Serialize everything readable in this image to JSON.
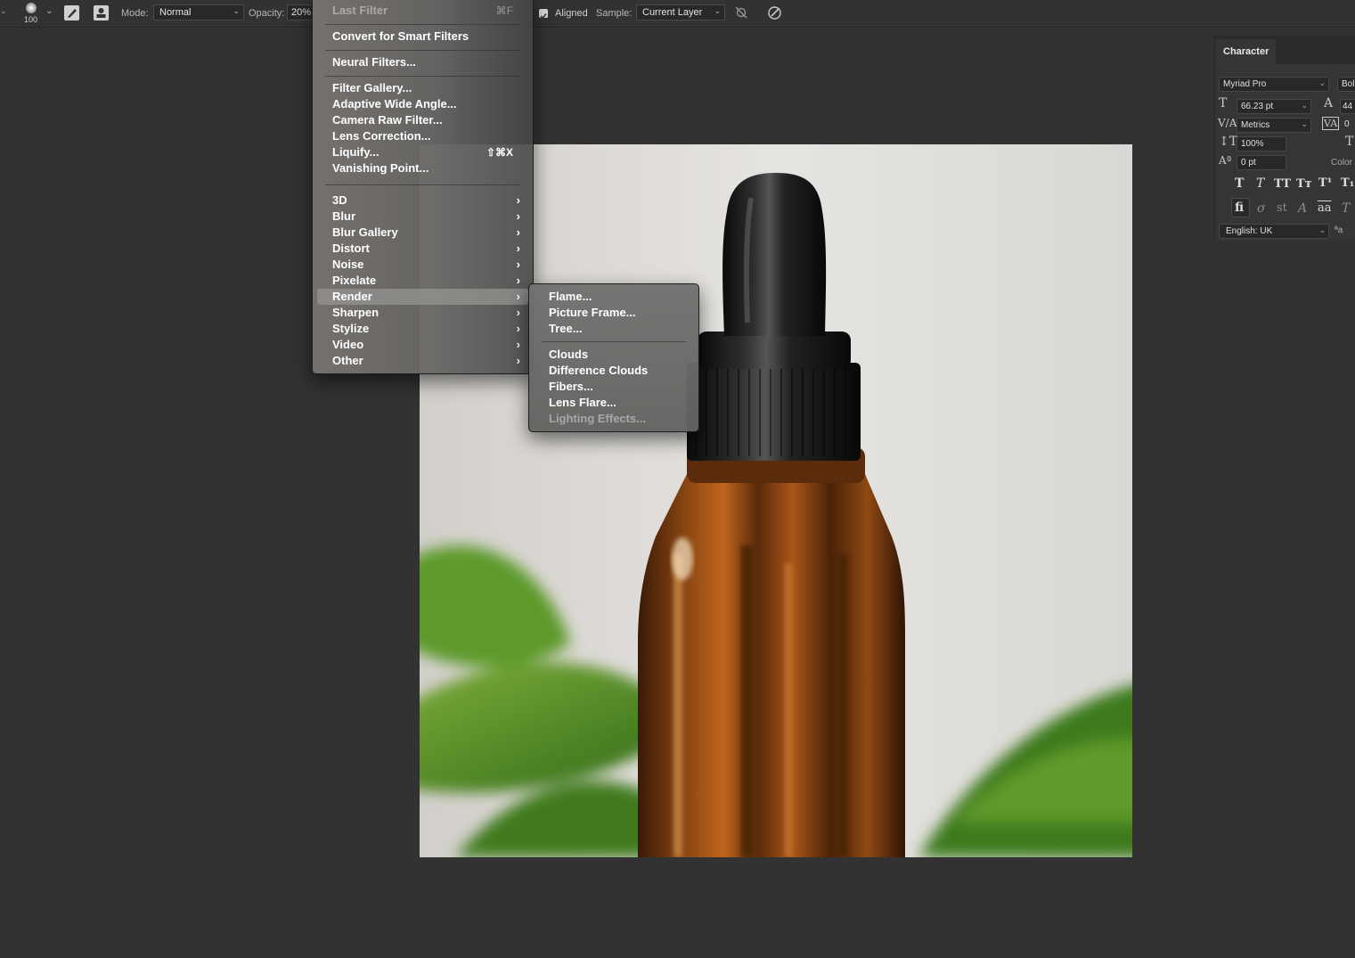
{
  "options_bar": {
    "brush_size": "100",
    "mode_label": "Mode:",
    "mode_value": "Normal",
    "opacity_label": "Opacity:",
    "opacity_value": "20%",
    "aligned_label": "Aligned",
    "aligned_checked": true,
    "sample_label": "Sample:",
    "sample_value": "Current Layer"
  },
  "filter_menu": {
    "last_filter": {
      "label": "Last Filter",
      "shortcut": "⌘F"
    },
    "convert": "Convert for Smart Filters",
    "neural": "Neural Filters...",
    "group1": [
      {
        "label": "Filter Gallery...",
        "shortcut": ""
      },
      {
        "label": "Adaptive Wide Angle...",
        "shortcut": ""
      },
      {
        "label": "Camera Raw Filter...",
        "shortcut": ""
      },
      {
        "label": "Lens Correction...",
        "shortcut": ""
      },
      {
        "label": "Liquify...",
        "shortcut": "⇧⌘X"
      },
      {
        "label": "Vanishing Point...",
        "shortcut": ""
      }
    ],
    "submenus": [
      "3D",
      "Blur",
      "Blur Gallery",
      "Distort",
      "Noise",
      "Pixelate",
      "Render",
      "Sharpen",
      "Stylize",
      "Video",
      "Other"
    ],
    "highlighted": "Render"
  },
  "render_submenu": {
    "group1": [
      "Flame...",
      "Picture Frame...",
      "Tree..."
    ],
    "group2": [
      "Clouds",
      "Difference Clouds",
      "Fibers...",
      "Lens Flare..."
    ],
    "disabled": "Lighting Effects..."
  },
  "character_panel": {
    "tab": "Character",
    "font_family": "Myriad Pro",
    "font_style": "Bol",
    "font_size": "66.23 pt",
    "leading": "44",
    "kerning": "Metrics",
    "tracking": "0",
    "vertical_scale": "100%",
    "baseline_shift": "0 pt",
    "color_label": "Color",
    "language": "English: UK",
    "aa_label": "ªa"
  },
  "colors": {
    "app_bg": "#323232",
    "menu_text": "#ffffff",
    "highlight": "#969492"
  }
}
